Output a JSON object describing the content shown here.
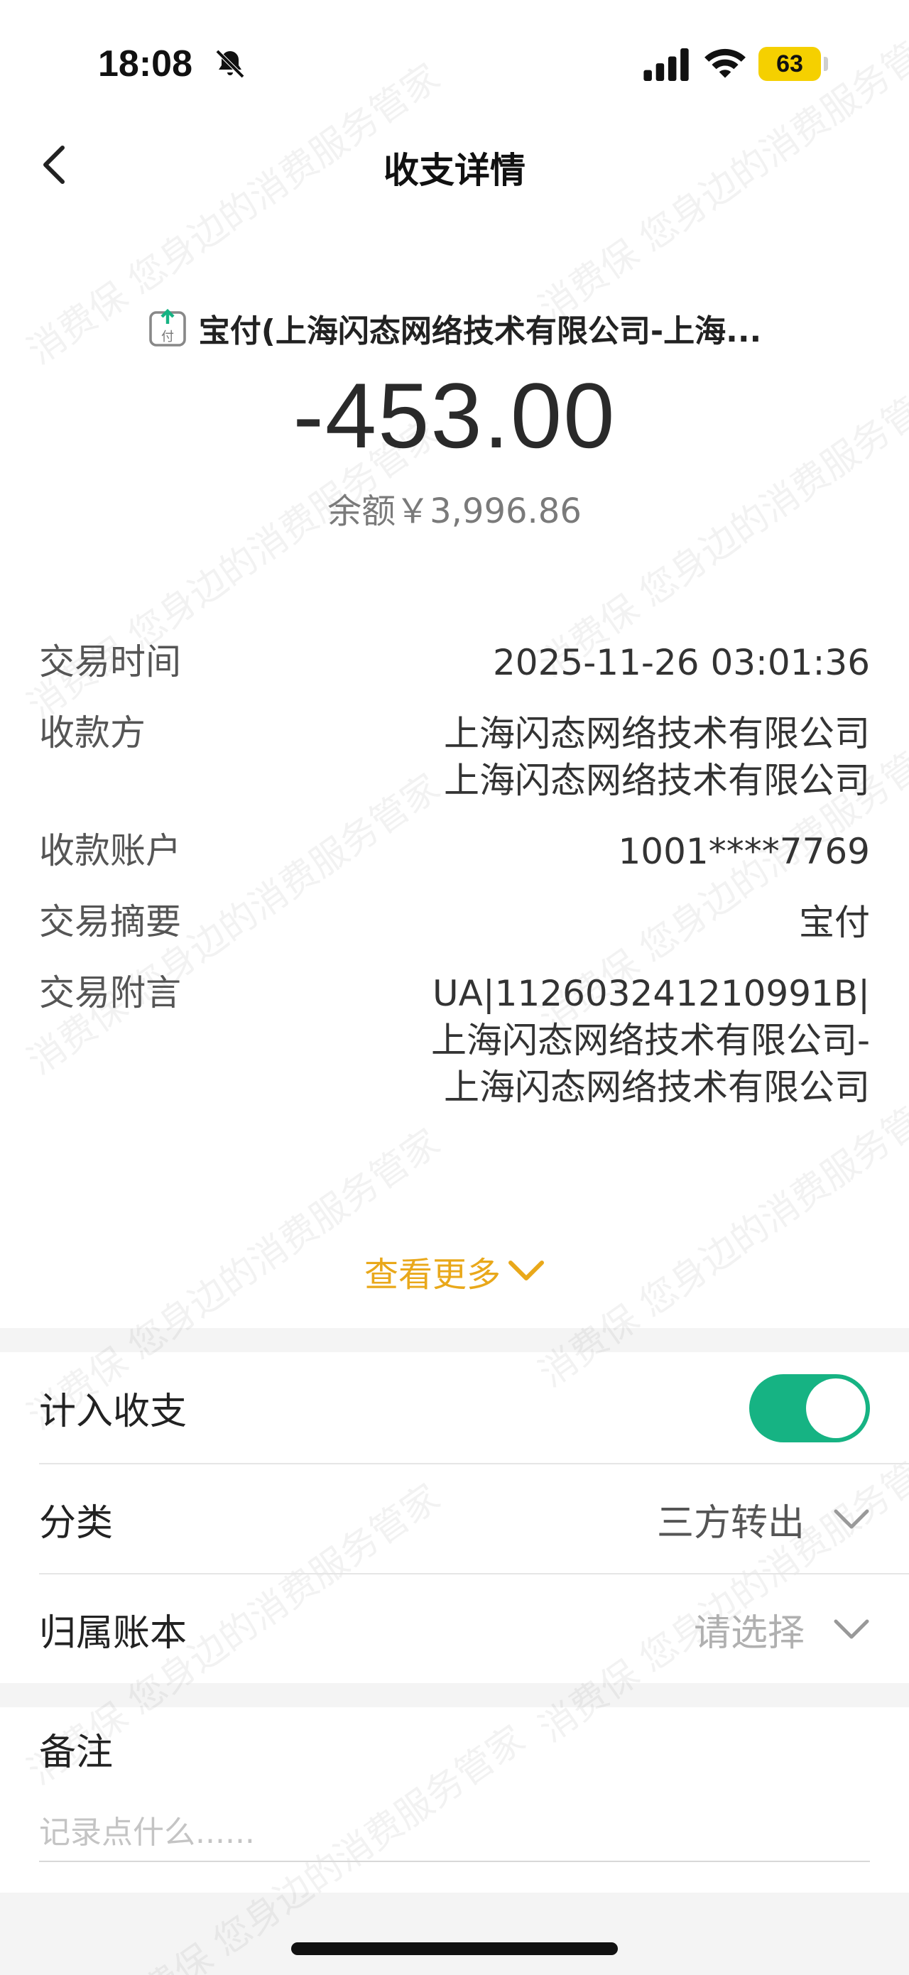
{
  "status_bar": {
    "time": "18:08",
    "battery": "63",
    "icons": [
      "bell-slash-icon",
      "signal-icon",
      "wifi-icon",
      "battery-icon"
    ]
  },
  "nav": {
    "title": "收支详情",
    "back_icon": "chevron-left-icon"
  },
  "header": {
    "merchant_icon": "pay-out-icon",
    "merchant": "宝付(上海闪态网络技术有限公司-上海...",
    "amount": "-453.00",
    "balance": "余额￥3,996.86"
  },
  "details": [
    {
      "label": "交易时间",
      "value": "2025-11-26 03:01:36"
    },
    {
      "label": "收款方",
      "value": "上海闪态网络技术有限公司上海闪态网络技术有限公司"
    },
    {
      "label": "收款账户",
      "value": "1001****7769"
    },
    {
      "label": "交易摘要",
      "value": "宝付"
    },
    {
      "label": "交易附言",
      "value": "UA|112603241210991B|上海闪态网络技术有限公司-上海闪态网络技术有限公司"
    }
  ],
  "more": {
    "label": "查看更多",
    "icon": "chevron-down-icon"
  },
  "settings": {
    "include": {
      "label": "计入收支",
      "enabled": true
    },
    "category": {
      "label": "分类",
      "value": "三方转出"
    },
    "ledger": {
      "label": "归属账本",
      "placeholder": "请选择"
    }
  },
  "note": {
    "label": "备注",
    "placeholder": "记录点什么......",
    "value": ""
  },
  "watermark": "消费保 您身边的消费服务管家",
  "colors": {
    "accent": "#e9a81a",
    "toggle_on": "#16b383",
    "battery": "#f5d000"
  }
}
